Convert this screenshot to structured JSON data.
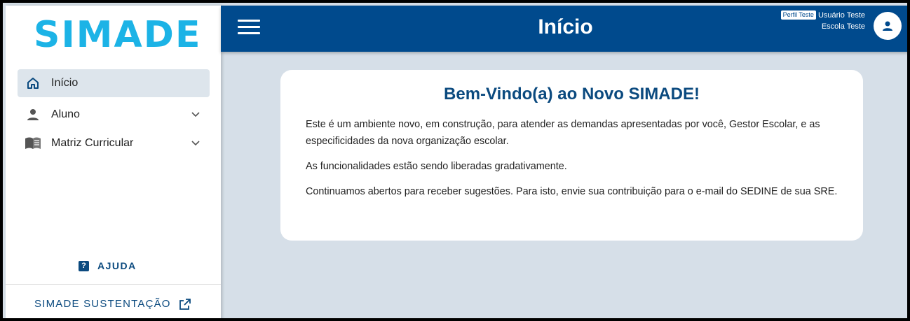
{
  "sidebar": {
    "logo": "SIMADE",
    "items": [
      {
        "label": "Início",
        "icon": "home-icon",
        "active": true
      },
      {
        "label": "Aluno",
        "icon": "person-icon",
        "expandable": true
      },
      {
        "label": "Matriz Curricular",
        "icon": "book-icon",
        "expandable": true
      }
    ],
    "help_label": "AJUDA",
    "footer_link": "SIMADE SUSTENTAÇÃO"
  },
  "header": {
    "title": "Início",
    "profile_badge": "Perfil Teste",
    "user_name": "Usuário Teste",
    "school": "Escola Teste"
  },
  "card": {
    "heading": "Bem-Vindo(a) ao Novo SIMADE!",
    "paragraphs": [
      "Este é um ambiente novo, em construção, para atender as demandas apresentadas por você, Gestor Escolar, e as especificidades da nova organização escolar.",
      "As funcionalidades estão sendo liberadas gradativamente.",
      "Continuamos abertos para receber sugestões. Para isto, envie sua contribuição para o e-mail do SEDINE de sua SRE."
    ]
  },
  "colors": {
    "header_bg": "#004a8d",
    "accent": "#0b4a7f",
    "page_bg": "#d6dfe8",
    "logo": "#1cb3e6"
  }
}
